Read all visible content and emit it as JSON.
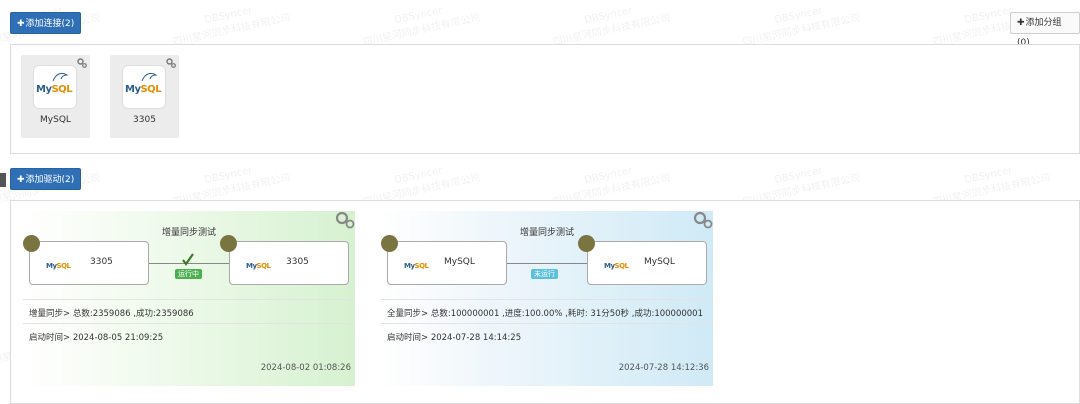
{
  "toolbar": {
    "add_connection_label": "添加连接(2)",
    "add_group_label": "添加分组(0)",
    "add_driver_label": "添加驱动(2)"
  },
  "connections": [
    {
      "name": "MySQL",
      "logo_my": "My",
      "logo_sql": "SQL"
    },
    {
      "name": "3305",
      "logo_my": "My",
      "logo_sql": "SQL"
    }
  ],
  "drivers": [
    {
      "title": "增量同步测试",
      "source_name": "3305",
      "target_name": "3305",
      "status": "运行中",
      "status_color": "#4caf50",
      "stats": "增量同步> 总数:2359086 ,成功:2359086",
      "start_time": "启动时间> 2024-08-05 21:09:25",
      "updated": "2024-08-02 01:08:26"
    },
    {
      "title": "增量同步测试",
      "source_name": "MySQL",
      "target_name": "MySQL",
      "status": "未运行",
      "status_color": "#5bc0de",
      "stats": "全量同步> 总数:100000001 ,进度:100.00% ,耗时: 31分50秒 ,成功:100000001",
      "start_time": "启动时间> 2024-07-28 14:14:25",
      "updated": "2024-07-28 14:12:36"
    }
  ],
  "watermark": {
    "brand": "DBSyncer",
    "company": "四川星河同步科技有限公司"
  },
  "colors": {
    "primary": "#2f6fb5",
    "node_dot": "#7a7440"
  }
}
